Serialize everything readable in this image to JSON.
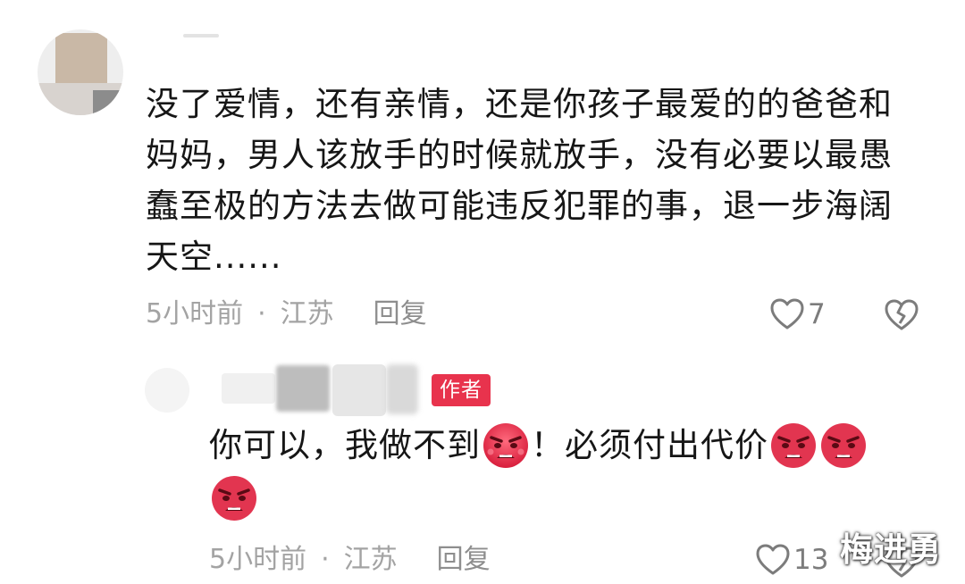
{
  "comments": [
    {
      "text": "没了爱情，还有亲情，还是你孩子最爱的的爸爸和妈妈，男人该放手的时候就放手，没有必要以最愚蠢至极的方法去做可能违反犯罪的事，退一步海阔天空......",
      "meta": {
        "time": "5小时前",
        "separator": "·",
        "location": "江苏",
        "reply_label": "回复"
      },
      "likes": "7",
      "icons": {
        "like": "heart-outline-icon",
        "dislike": "broken-heart-icon"
      }
    },
    {
      "author_badge": "作者",
      "text_parts": [
        "你可以，我做不到",
        "！必须付出代价"
      ],
      "emoji": "angry-face-emoji",
      "meta": {
        "time": "5小时前",
        "separator": "·",
        "location": "江苏",
        "reply_label": "回复"
      },
      "likes": "13",
      "icons": {
        "like": "heart-outline-icon",
        "dislike": "broken-heart-icon"
      }
    }
  ],
  "watermark": "梅进勇",
  "colors": {
    "badge": "#e8334d",
    "meta": "#a3a3a3",
    "emoji": "#e8334d"
  }
}
